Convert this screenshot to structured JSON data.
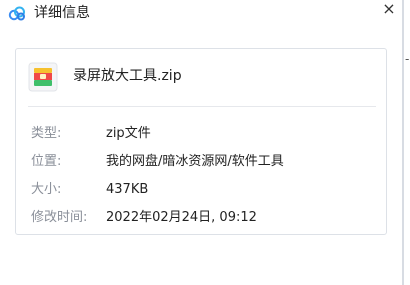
{
  "window": {
    "title": "详细信息",
    "close_glyph": "×",
    "edge_glyph": "-",
    "app_icon": "cloud-icon"
  },
  "file": {
    "icon": "zip-archive-icon",
    "name": "录屏放大工具.zip"
  },
  "details": [
    {
      "label": "类型:",
      "value": "zip文件"
    },
    {
      "label": "位置:",
      "value": "我的网盘/暗冰资源网/软件工具"
    },
    {
      "label": "大小:",
      "value": "437KB"
    },
    {
      "label": "修改时间:",
      "value": "2022年02月24日, 09:12"
    }
  ],
  "colors": {
    "label": "#8a8f99",
    "accent_blue": "#3b8cf2",
    "zip_red": "#f04848",
    "zip_yellow": "#f6c12e",
    "zip_green": "#3fbf6a"
  }
}
